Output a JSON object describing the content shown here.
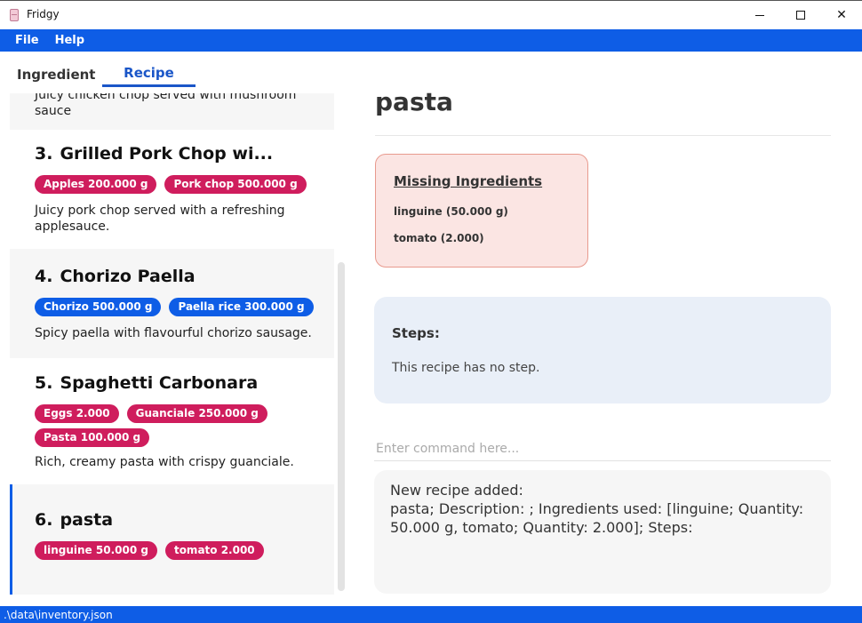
{
  "window": {
    "title": "Fridgy"
  },
  "menu": {
    "file": "File",
    "help": "Help"
  },
  "tabs": {
    "ingredient": "Ingredient",
    "recipe": "Recipe"
  },
  "recipes": [
    {
      "number": "",
      "name": "",
      "tags": [],
      "description": "Juicy chicken chop served with mushroom sauce"
    },
    {
      "number": "3.",
      "name": "Grilled Pork Chop wi...",
      "tags": [
        "Apples 200.000 g",
        "Pork chop 500.000 g"
      ],
      "tag_color": "red",
      "description": "Juicy pork chop served with a refreshing applesauce."
    },
    {
      "number": "4.",
      "name": "Chorizo Paella",
      "tags": [
        "Chorizo 500.000 g",
        "Paella rice 300.000 g"
      ],
      "tag_color": "blue",
      "description": "Spicy paella with flavourful chorizo sausage."
    },
    {
      "number": "5.",
      "name": "Spaghetti Carbonara",
      "tags": [
        "Eggs 2.000",
        "Guanciale 250.000 g",
        "Pasta 100.000 g"
      ],
      "tag_color": "red",
      "description": "Rich, creamy pasta with crispy guanciale."
    },
    {
      "number": "6.",
      "name": "pasta",
      "tags": [
        "linguine 50.000 g",
        "tomato 2.000"
      ],
      "tag_color": "red",
      "description": ""
    }
  ],
  "detail": {
    "title": "pasta",
    "missing_title": "Missing Ingredients",
    "missing_items": [
      "linguine (50.000 g)",
      "tomato (2.000)"
    ],
    "steps_title": "Steps:",
    "steps_text": "This recipe has no step."
  },
  "command": {
    "placeholder": "Enter command here...",
    "value": ""
  },
  "result": {
    "lines": [
      "New recipe added:",
      "pasta; Description: ; Ingredients used: [linguine; Quantity: 50.000 g, tomato; Quantity: 2.000]; Steps:"
    ]
  },
  "status": {
    "path": ".\\data\\inventory.json"
  },
  "colors": {
    "accent": "#0e5de6",
    "tag_red": "#cf1d5d",
    "tag_blue": "#0e5de6",
    "missing_bg": "#fbe5e3",
    "steps_bg": "#e9eff8"
  }
}
